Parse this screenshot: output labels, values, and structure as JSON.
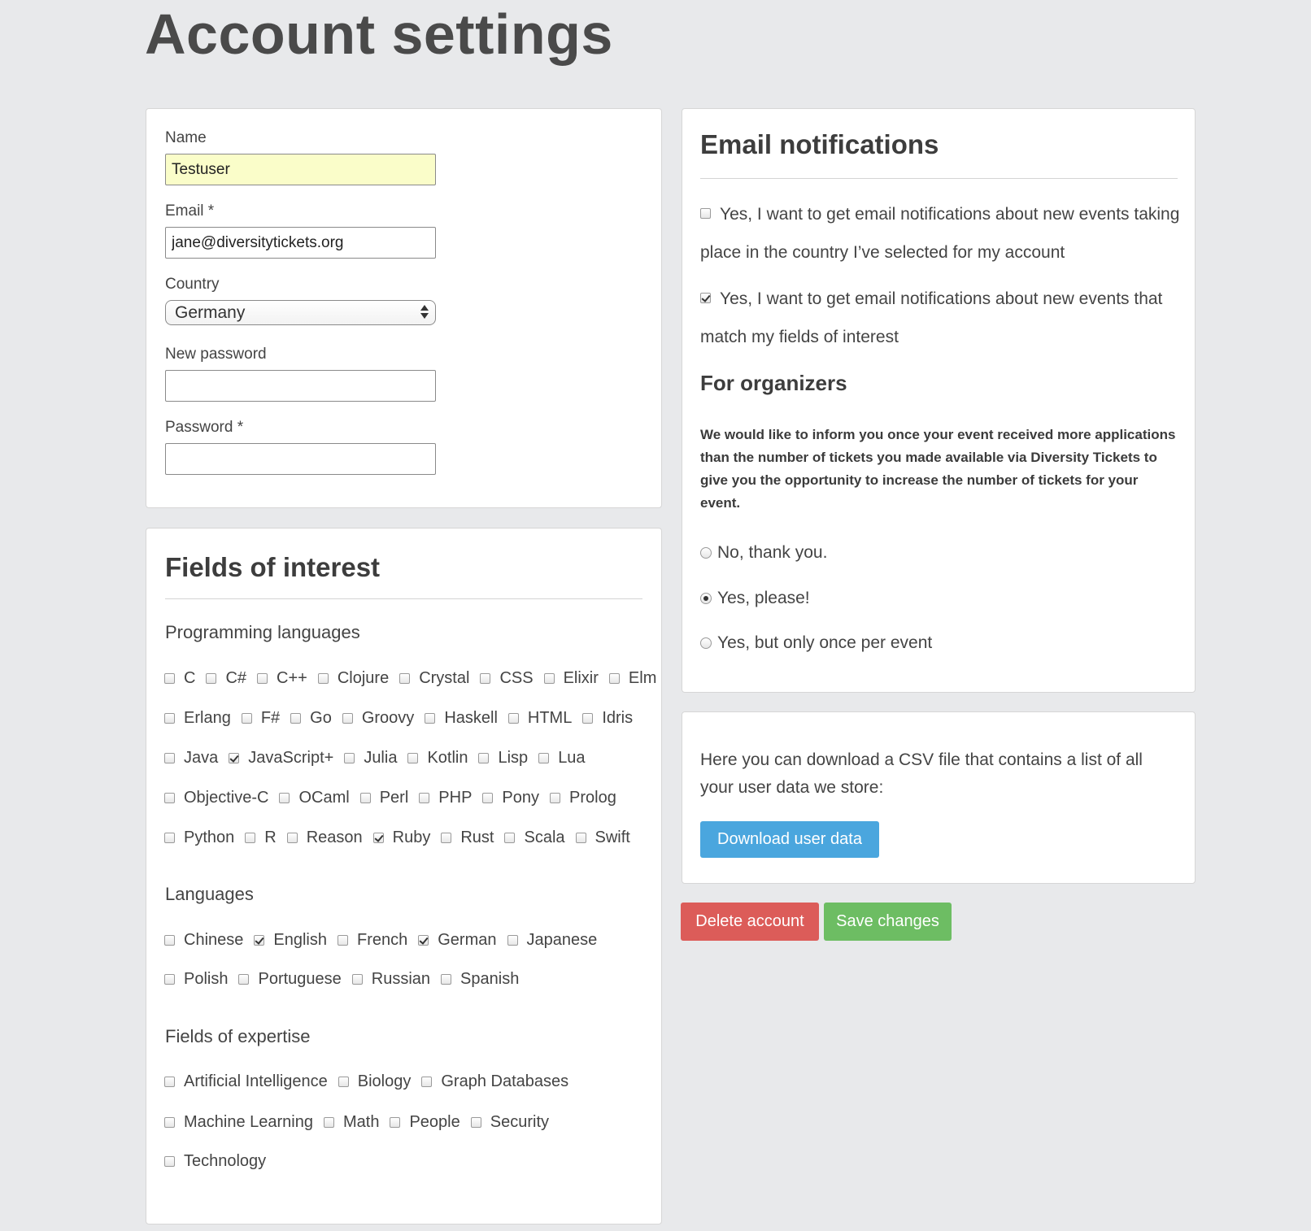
{
  "page": {
    "title": "Account settings"
  },
  "account": {
    "name_label": "Name",
    "name_value": "Testuser",
    "email_label": "Email *",
    "email_value": "jane@diversitytickets.org",
    "country_label": "Country",
    "country_value": "Germany",
    "new_password_label": "New password",
    "password_label": "Password *"
  },
  "interests": {
    "title": "Fields of interest",
    "programming": {
      "heading": "Programming languages",
      "rows": [
        [
          {
            "label": "C",
            "checked": false
          },
          {
            "label": "C#",
            "checked": false
          },
          {
            "label": "C++",
            "checked": false
          },
          {
            "label": "Clojure",
            "checked": false
          },
          {
            "label": "Crystal",
            "checked": false
          },
          {
            "label": "CSS",
            "checked": false
          },
          {
            "label": "Elixir",
            "checked": false
          },
          {
            "label": "Elm",
            "checked": false
          }
        ],
        [
          {
            "label": "Erlang",
            "checked": false
          },
          {
            "label": "F#",
            "checked": false
          },
          {
            "label": "Go",
            "checked": false
          },
          {
            "label": "Groovy",
            "checked": false
          },
          {
            "label": "Haskell",
            "checked": false
          },
          {
            "label": "HTML",
            "checked": false
          },
          {
            "label": "Idris",
            "checked": false
          }
        ],
        [
          {
            "label": "Java",
            "checked": false
          },
          {
            "label": "JavaScript+",
            "checked": true
          },
          {
            "label": "Julia",
            "checked": false
          },
          {
            "label": "Kotlin",
            "checked": false
          },
          {
            "label": "Lisp",
            "checked": false
          },
          {
            "label": "Lua",
            "checked": false
          }
        ],
        [
          {
            "label": "Objective-C",
            "checked": false
          },
          {
            "label": "OCaml",
            "checked": false
          },
          {
            "label": "Perl",
            "checked": false
          },
          {
            "label": "PHP",
            "checked": false
          },
          {
            "label": "Pony",
            "checked": false
          },
          {
            "label": "Prolog",
            "checked": false
          }
        ],
        [
          {
            "label": "Python",
            "checked": false
          },
          {
            "label": "R",
            "checked": false
          },
          {
            "label": "Reason",
            "checked": false
          },
          {
            "label": "Ruby",
            "checked": true
          },
          {
            "label": "Rust",
            "checked": false
          },
          {
            "label": "Scala",
            "checked": false
          },
          {
            "label": "Swift",
            "checked": false
          }
        ]
      ]
    },
    "languages": {
      "heading": "Languages",
      "rows": [
        [
          {
            "label": "Chinese",
            "checked": false
          },
          {
            "label": "English",
            "checked": true
          },
          {
            "label": "French",
            "checked": false
          },
          {
            "label": "German",
            "checked": true
          },
          {
            "label": "Japanese",
            "checked": false
          }
        ],
        [
          {
            "label": "Polish",
            "checked": false
          },
          {
            "label": "Portuguese",
            "checked": false
          },
          {
            "label": "Russian",
            "checked": false
          },
          {
            "label": "Spanish",
            "checked": false
          }
        ]
      ]
    },
    "expertise": {
      "heading": "Fields of expertise",
      "rows": [
        [
          {
            "label": "Artificial Intelligence",
            "checked": false
          },
          {
            "label": "Biology",
            "checked": false
          },
          {
            "label": "Graph Databases",
            "checked": false
          }
        ],
        [
          {
            "label": "Machine Learning",
            "checked": false
          },
          {
            "label": "Math",
            "checked": false
          },
          {
            "label": "People",
            "checked": false
          },
          {
            "label": "Security",
            "checked": false
          }
        ],
        [
          {
            "label": "Technology",
            "checked": false
          }
        ]
      ]
    }
  },
  "notifications": {
    "title": "Email notifications",
    "country_option": {
      "label": "Yes, I want to get email notifications about new events taking place in the country I’ve selected for my account",
      "checked": false
    },
    "interest_option": {
      "label": "Yes, I want to get email notifications about new events that match my fields of interest",
      "checked": true
    },
    "organizers_heading": "For organizers",
    "organizers_text": "We would like to inform you once your event received more applications than the number of tickets you made available via Diversity Tickets to give you the opportunity to increase the number of tickets for your event.",
    "radio_options": [
      {
        "label": "No, thank you.",
        "checked": false
      },
      {
        "label": "Yes, please!",
        "checked": true
      },
      {
        "label": "Yes, but only once per event",
        "checked": false
      }
    ]
  },
  "download": {
    "text": "Here you can download a CSV file that contains a list of all your user data we store:",
    "button_label": "Download user data"
  },
  "actions": {
    "delete_label": "Delete account",
    "save_label": "Save changes"
  },
  "colors": {
    "page_bg": "#e8e9eb",
    "autofill_bg": "#fafdc9",
    "download_button": "#4aa6de",
    "delete_button": "#dc5c59",
    "save_button": "#6dbd63"
  }
}
